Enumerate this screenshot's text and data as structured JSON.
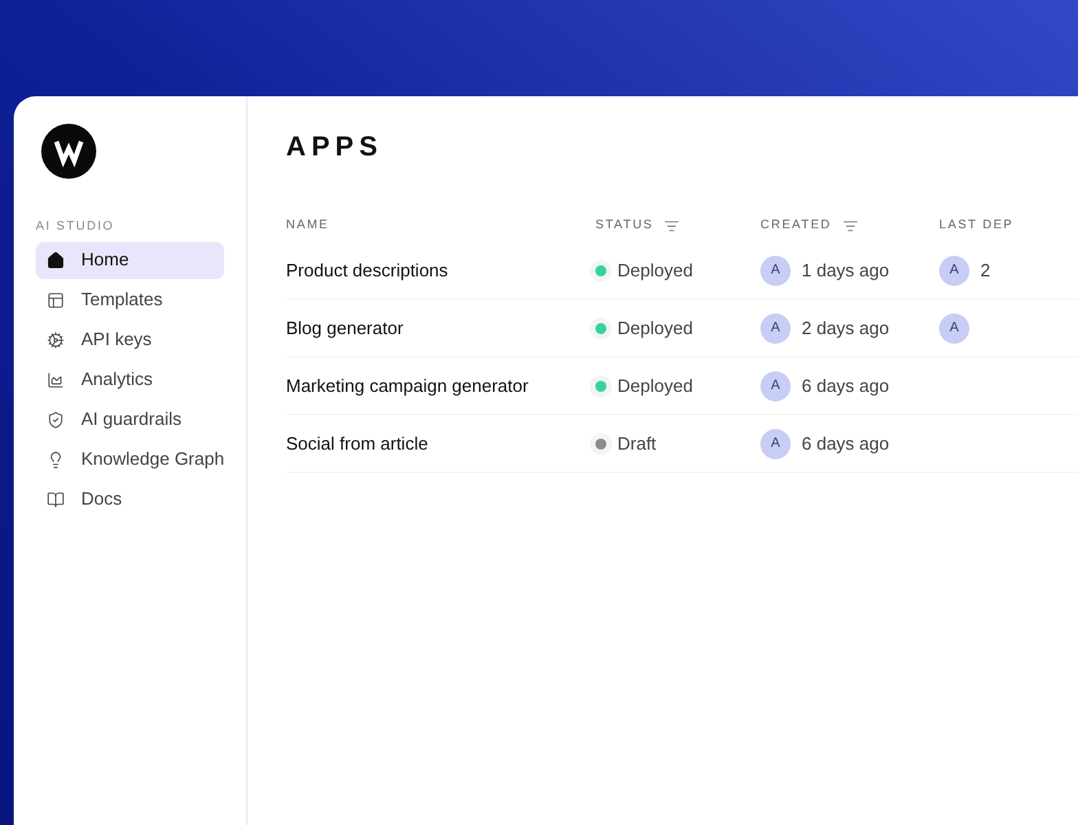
{
  "sidebar": {
    "section_label": "AI STUDIO",
    "items": [
      {
        "label": "Home",
        "selected": true
      },
      {
        "label": "Templates",
        "selected": false
      },
      {
        "label": "API keys",
        "selected": false
      },
      {
        "label": "Analytics",
        "selected": false
      },
      {
        "label": "AI guardrails",
        "selected": false
      },
      {
        "label": "Knowledge Graph",
        "selected": false
      },
      {
        "label": "Docs",
        "selected": false
      }
    ]
  },
  "page_title": "APPS",
  "table": {
    "columns": [
      {
        "label": "NAME",
        "filterable": false
      },
      {
        "label": "STATUS",
        "filterable": true
      },
      {
        "label": "CREATED",
        "filterable": true
      },
      {
        "label": "LAST DEP",
        "filterable": false
      }
    ],
    "rows": [
      {
        "name": "Product descriptions",
        "status": "Deployed",
        "color": "#34d399",
        "created": {
          "avatar": "A",
          "text": "1 days ago"
        },
        "last_deployed": {
          "avatar": "A",
          "text": "2"
        }
      },
      {
        "name": "Blog generator",
        "status": "Deployed",
        "color": "#34d399",
        "created": {
          "avatar": "A",
          "text": "2 days ago"
        },
        "last_deployed": {
          "avatar": "A"
        }
      },
      {
        "name": "Marketing campaign generator",
        "status": "Deployed",
        "color": "#34d399",
        "created": {
          "avatar": "A",
          "text": "6 days ago"
        }
      },
      {
        "name": "Social from article",
        "status": "Draft",
        "color": "#8b8b8b",
        "created": {
          "avatar": "A",
          "text": "6 days ago"
        }
      }
    ]
  }
}
